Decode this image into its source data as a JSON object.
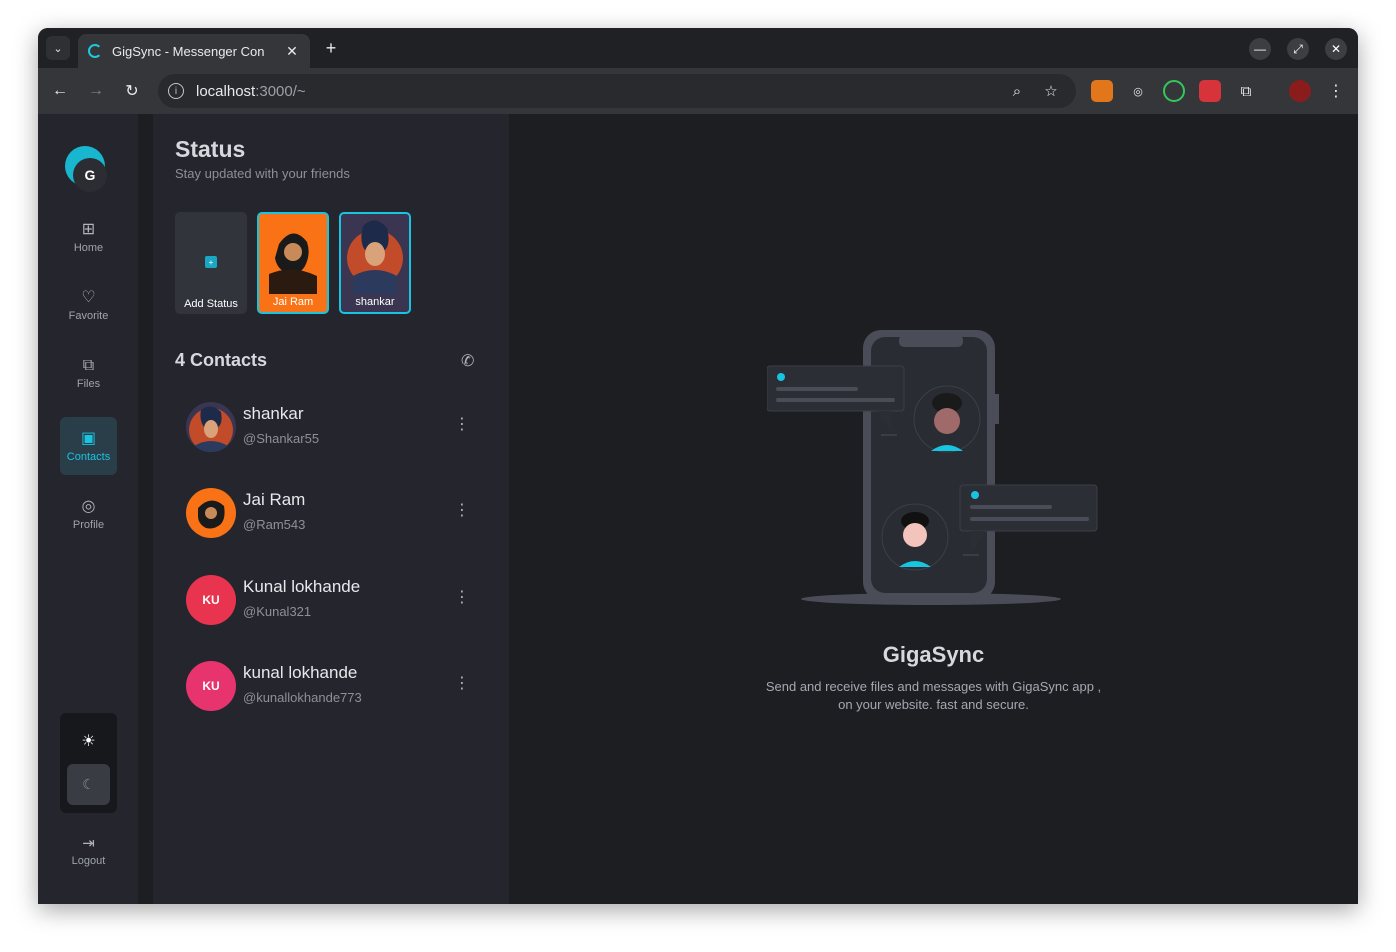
{
  "browser": {
    "tab_title": "GigSync - Messenger Con",
    "tab_close": "✕",
    "new_tab": "+",
    "url_host": "localhost",
    "url_path": ":3000/~"
  },
  "app": {
    "logo_letter": "G",
    "nav": [
      {
        "label": "Home",
        "icon": "⊞"
      },
      {
        "label": "Favorite",
        "icon": "♡"
      },
      {
        "label": "Files",
        "icon": "⧉"
      },
      {
        "label": "Contacts",
        "icon": "▣"
      },
      {
        "label": "Profile",
        "icon": "◎"
      }
    ],
    "theme": {
      "sun": "☀",
      "moon": "☾"
    },
    "logout_label": "Logout"
  },
  "status": {
    "title": "Status",
    "subtitle": "Stay updated with your friends",
    "stories": [
      {
        "label": "Add Status"
      },
      {
        "label": "Jai Ram"
      },
      {
        "label": "shankar"
      }
    ]
  },
  "contacts": {
    "title": "4 Contacts",
    "items": [
      {
        "name": "shankar",
        "handle": "@Shankar55",
        "initials": ""
      },
      {
        "name": "Jai Ram",
        "handle": "@Ram543",
        "initials": ""
      },
      {
        "name": "Kunal lokhande",
        "handle": "@Kunal321",
        "initials": "KU"
      },
      {
        "name": "kunal lokhande",
        "handle": "@kunallokhande773",
        "initials": "KU"
      }
    ]
  },
  "welcome": {
    "brand": "GigaSync",
    "line1": "Send and receive files and messages with GigaSync app ,",
    "line2": "on your website. fast and secure."
  },
  "colors": {
    "accent": "#19c4e0",
    "panel": "#25262d",
    "main": "#1d1e22",
    "jai_ram_bg": "#f97316",
    "kunal_avatar": "#e8344e"
  }
}
